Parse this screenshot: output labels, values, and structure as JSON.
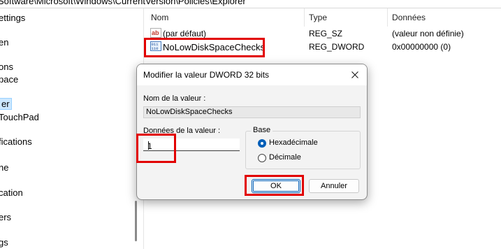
{
  "address_bar": {
    "path": "Software\\Microsoft\\Windows\\CurrentVersion\\Policies\\Explorer"
  },
  "tree": {
    "items": [
      {
        "label": "ettings"
      },
      {
        "label": "en"
      },
      {
        "label": "ons"
      },
      {
        "label": "pace"
      },
      {
        "label": "er",
        "selected": true
      },
      {
        "label": "TouchPad"
      },
      {
        "label": "fications"
      },
      {
        "label": "ne"
      },
      {
        "label": "cation"
      },
      {
        "label": "ers"
      },
      {
        "label": "gs"
      }
    ]
  },
  "list": {
    "headers": {
      "name": "Nom",
      "type": "Type",
      "data": "Données"
    },
    "rows": [
      {
        "icon": "string-value-icon",
        "name": "(par défaut)",
        "type": "REG_SZ",
        "data": "(valeur non définie)"
      },
      {
        "icon": "binary-value-icon",
        "name": "NoLowDiskSpaceChecks",
        "type": "REG_DWORD",
        "data": "0x00000000 (0)"
      }
    ]
  },
  "dialog": {
    "title": "Modifier la valeur DWORD 32 bits",
    "value_name_label": "Nom de la valeur :",
    "value_name": "NoLowDiskSpaceChecks",
    "value_data_label": "Données de la valeur :",
    "value_data": "1",
    "base_label": "Base",
    "base_options": [
      {
        "label": "Hexadécimale",
        "selected": true
      },
      {
        "label": "Décimale",
        "selected": false
      }
    ],
    "ok_label": "OK",
    "cancel_label": "Annuler"
  },
  "colors": {
    "highlight": "#e20000",
    "accent": "#005fb8",
    "selection": "#cce8ff"
  }
}
